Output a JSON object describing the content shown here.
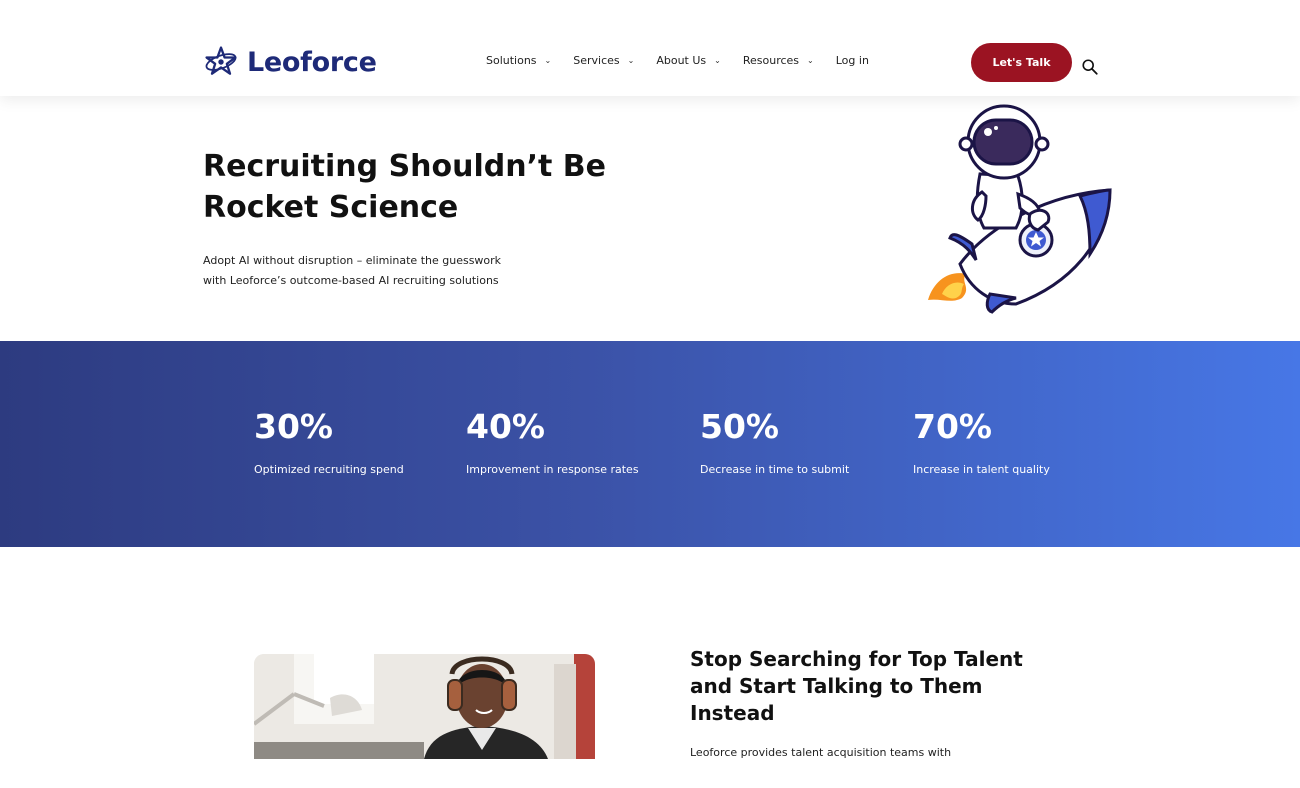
{
  "brand": {
    "name": "Leoforce",
    "logo_icon": "star-orbit-icon",
    "color": "#1e2a78"
  },
  "nav": {
    "items": [
      {
        "label": "Solutions",
        "has_dropdown": true
      },
      {
        "label": "Services",
        "has_dropdown": true
      },
      {
        "label": "About Us",
        "has_dropdown": true
      },
      {
        "label": "Resources",
        "has_dropdown": true
      },
      {
        "label": "Log in",
        "has_dropdown": false
      }
    ],
    "cta_label": "Let's Talk",
    "cta_color": "#9b1322",
    "search_icon": "search-icon"
  },
  "hero": {
    "title_line1": "Recruiting Shouldn’t Be",
    "title_line2": "Rocket Science",
    "subtitle_line1": "Adopt AI without disruption – eliminate the guesswork",
    "subtitle_line2": "with Leoforce’s outcome-based AI recruiting solutions",
    "illustration": "astronaut-on-rocket-illustration"
  },
  "stats": [
    {
      "value": "30%",
      "label": "Optimized recruiting spend"
    },
    {
      "value": "40%",
      "label": "Improvement in response rates"
    },
    {
      "value": "50%",
      "label": "Decrease in time to submit"
    },
    {
      "value": "70%",
      "label": "Increase in talent quality"
    }
  ],
  "stats_gradient": {
    "start": "#2d3b80",
    "end": "#4777e6"
  },
  "feature": {
    "title": "Stop Searching for Top Talent and Start Talking to Them Instead",
    "text": "Leoforce provides talent acquisition teams with",
    "image": "man-with-headphones-photo"
  }
}
